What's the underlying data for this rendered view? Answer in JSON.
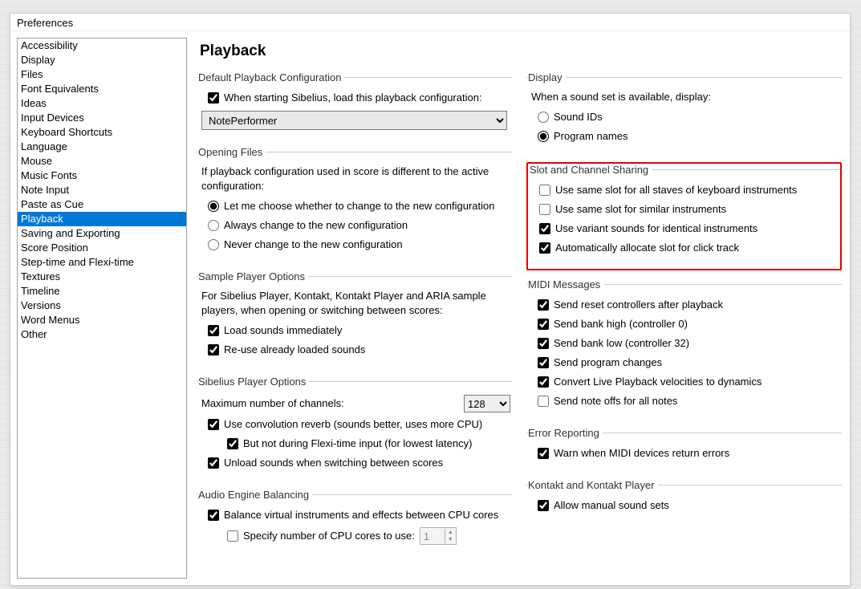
{
  "dialog_title": "Preferences",
  "page_title": "Playback",
  "sidebar": {
    "items": [
      {
        "label": "Accessibility"
      },
      {
        "label": "Display"
      },
      {
        "label": "Files"
      },
      {
        "label": "Font Equivalents"
      },
      {
        "label": "Ideas"
      },
      {
        "label": "Input Devices"
      },
      {
        "label": "Keyboard Shortcuts"
      },
      {
        "label": "Language"
      },
      {
        "label": "Mouse"
      },
      {
        "label": "Music Fonts"
      },
      {
        "label": "Note Input"
      },
      {
        "label": "Paste as Cue"
      },
      {
        "label": "Playback",
        "active": true
      },
      {
        "label": "Saving and Exporting"
      },
      {
        "label": "Score Position"
      },
      {
        "label": "Step-time and Flexi-time"
      },
      {
        "label": "Textures"
      },
      {
        "label": "Timeline"
      },
      {
        "label": "Versions"
      },
      {
        "label": "Word Menus"
      },
      {
        "label": "Other"
      }
    ]
  },
  "default_playback": {
    "legend": "Default Playback Configuration",
    "check_label": "When starting Sibelius, load this playback configuration:",
    "checked": true,
    "combo_value": "NotePerformer"
  },
  "opening_files": {
    "legend": "Opening Files",
    "desc": "If playback configuration used in score is different to the active configuration:",
    "radios": [
      {
        "label": "Let me choose whether to change to the new configuration",
        "checked": true
      },
      {
        "label": "Always change to the new configuration",
        "checked": false
      },
      {
        "label": "Never change to the new configuration",
        "checked": false
      }
    ]
  },
  "sample_player": {
    "legend": "Sample Player Options",
    "desc": "For Sibelius Player, Kontakt, Kontakt Player and ARIA sample players, when opening or switching between scores:",
    "checks": [
      {
        "label": "Load sounds immediately",
        "checked": true
      },
      {
        "label": "Re-use already loaded sounds",
        "checked": true
      }
    ]
  },
  "sibelius_player": {
    "legend": "Sibelius Player Options",
    "max_channels_label": "Maximum number of channels:",
    "max_channels_value": "128",
    "checks": [
      {
        "label": "Use convolution reverb (sounds better, uses more CPU)",
        "checked": true
      },
      {
        "label": "But not during Flexi-time input (for lowest latency)",
        "checked": true,
        "indent": true
      },
      {
        "label": "Unload sounds when switching between scores",
        "checked": true
      }
    ]
  },
  "audio_engine": {
    "legend": "Audio Engine Balancing",
    "balance": {
      "label": "Balance virtual instruments and effects between CPU cores",
      "checked": true
    },
    "specify": {
      "label": "Specify number of CPU cores to use:",
      "checked": false,
      "value": "1"
    }
  },
  "display": {
    "legend": "Display",
    "desc": "When a sound set is available, display:",
    "radios": [
      {
        "label": "Sound IDs",
        "checked": false
      },
      {
        "label": "Program names",
        "checked": true
      }
    ]
  },
  "slot_channel": {
    "legend": "Slot and Channel Sharing",
    "checks": [
      {
        "label": "Use same slot for all staves of keyboard instruments",
        "checked": false
      },
      {
        "label": "Use same slot for similar instruments",
        "checked": false
      },
      {
        "label": "Use variant sounds for identical instruments",
        "checked": true
      },
      {
        "label": "Automatically allocate slot for click track",
        "checked": true
      }
    ]
  },
  "midi_messages": {
    "legend": "MIDI Messages",
    "checks": [
      {
        "label": "Send reset controllers after playback",
        "checked": true
      },
      {
        "label": "Send bank high (controller 0)",
        "checked": true
      },
      {
        "label": "Send bank low (controller 32)",
        "checked": true
      },
      {
        "label": "Send program changes",
        "checked": true
      },
      {
        "label": "Convert Live Playback velocities to dynamics",
        "checked": true
      },
      {
        "label": "Send note offs for all notes",
        "checked": false
      }
    ]
  },
  "error_reporting": {
    "legend": "Error Reporting",
    "check": {
      "label": "Warn when MIDI devices return errors",
      "checked": true
    }
  },
  "kontakt": {
    "legend": "Kontakt and Kontakt Player",
    "check": {
      "label": "Allow manual sound sets",
      "checked": true
    }
  }
}
